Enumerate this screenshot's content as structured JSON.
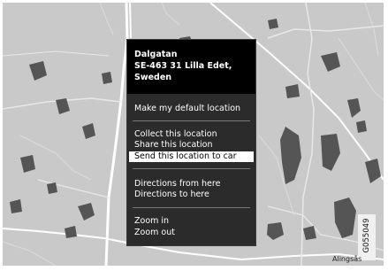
{
  "location": {
    "street": "Dalgatan",
    "postal_city": "SE-463 31 Lilla Edet,",
    "country": "Sweden"
  },
  "menu": {
    "make_default": "Make my default location",
    "collect": "Collect this location",
    "share": "Share this location",
    "send_to_car": "Send this location to car",
    "directions_from": "Directions from here",
    "directions_to": "Directions to here",
    "zoom_in": "Zoom in",
    "zoom_out": "Zoom out",
    "selected_item": "send_to_car"
  },
  "map_labels": {
    "bottom_right": "Alingsås"
  },
  "figure_code": "G055049",
  "colors": {
    "map_land": "#c9c9c9",
    "map_lakes": "#555555",
    "menu_bg": "#2b2b2b",
    "menu_header": "#000000",
    "selection_bg": "#ffffff"
  }
}
